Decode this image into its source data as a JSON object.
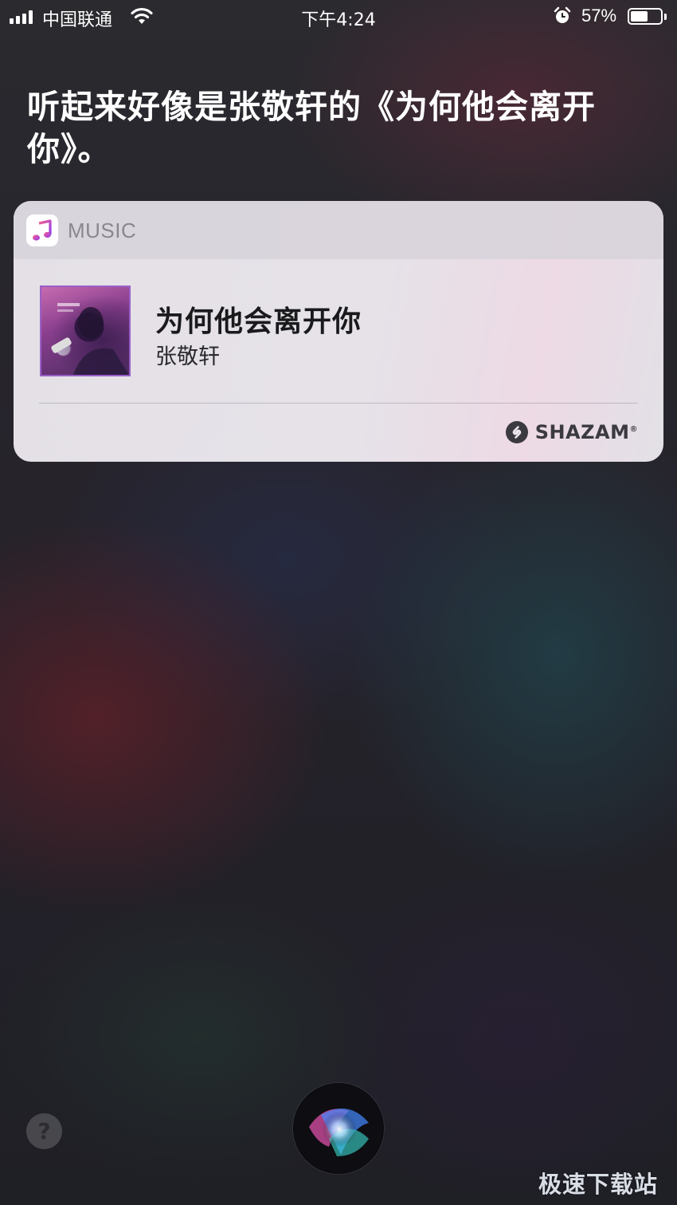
{
  "status_bar": {
    "carrier": "中国联通",
    "time": "下午4:24",
    "battery_percent_text": "57%",
    "battery_level": 0.57
  },
  "siri": {
    "response_text": "听起来好像是张敬轩的《为何他会离开你》。"
  },
  "card": {
    "app_name": "MUSIC",
    "song_title": "为何他会离开你",
    "artist": "张敬轩",
    "source_label": "SHAZAM",
    "source_suffix": "®"
  },
  "controls": {
    "help_label": "?"
  },
  "watermark": {
    "text": "极速下载站"
  },
  "colors": {
    "card_background": "#ece8ee",
    "album_border": "#9a5fc7",
    "music_icon": "#fc3c5c"
  },
  "icons": [
    "signal-icon",
    "wifi-icon",
    "alarm-icon",
    "battery-icon",
    "music-app-icon",
    "shazam-logo-icon",
    "siri-orb-icon",
    "help-icon"
  ]
}
